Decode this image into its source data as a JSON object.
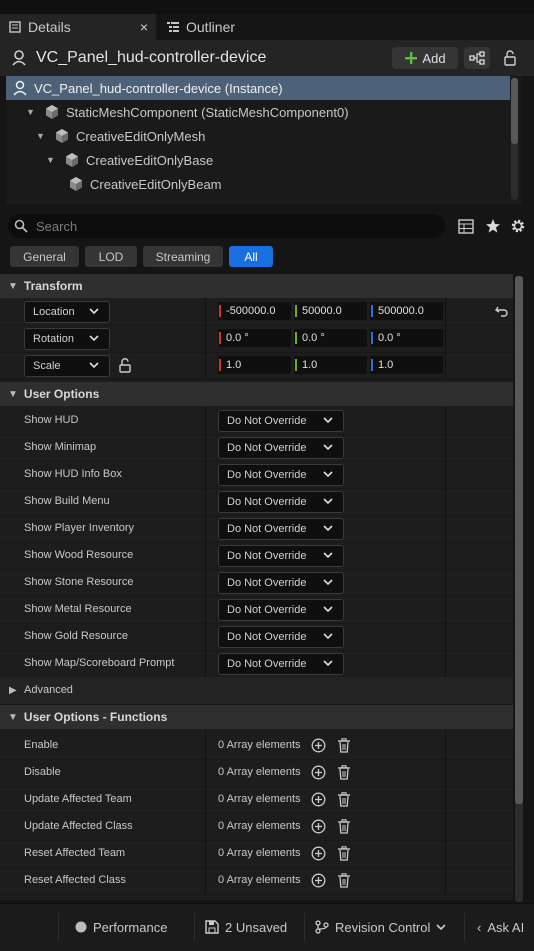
{
  "tabs": [
    {
      "label": "Details",
      "icon": "details-icon",
      "close": "×"
    },
    {
      "label": "Outliner",
      "icon": "outliner-icon"
    }
  ],
  "header": {
    "title": "VC_Panel_hud-controller-device",
    "add_label": "Add"
  },
  "tree": [
    {
      "label": "VC_Panel_hud-controller-device (Instance)",
      "selected": true
    },
    {
      "label": "StaticMeshComponent (StaticMeshComponent0)"
    },
    {
      "label": "CreativeEditOnlyMesh"
    },
    {
      "label": "CreativeEditOnlyBase"
    },
    {
      "label": "CreativeEditOnlyBeam"
    }
  ],
  "search": {
    "placeholder": "Search"
  },
  "filters": [
    "General",
    "LOD",
    "Streaming",
    "All"
  ],
  "active_filter": "All",
  "transform": {
    "title": "Transform",
    "rows": [
      {
        "label": "Location",
        "values": [
          "-500000.0",
          "50000.0",
          "500000.0"
        ]
      },
      {
        "label": "Rotation",
        "values": [
          "0.0 °",
          "0.0 °",
          "0.0 °"
        ]
      },
      {
        "label": "Scale",
        "values": [
          "1.0",
          "1.0",
          "1.0"
        ]
      }
    ]
  },
  "axis_colors": [
    "#c93a2e",
    "#6fae1c",
    "#2f6fd9"
  ],
  "user_options": {
    "title": "User Options",
    "rows": [
      {
        "label": "Show HUD",
        "value": "Do Not Override"
      },
      {
        "label": "Show Minimap",
        "value": "Do Not Override"
      },
      {
        "label": "Show HUD Info Box",
        "value": "Do Not Override"
      },
      {
        "label": "Show Build Menu",
        "value": "Do Not Override"
      },
      {
        "label": "Show Player Inventory",
        "value": "Do Not Override"
      },
      {
        "label": "Show Wood Resource",
        "value": "Do Not Override"
      },
      {
        "label": "Show Stone Resource",
        "value": "Do Not Override"
      },
      {
        "label": "Show Metal Resource",
        "value": "Do Not Override"
      },
      {
        "label": "Show Gold Resource",
        "value": "Do Not Override"
      },
      {
        "label": "Show Map/Scoreboard Prompt",
        "value": "Do Not Override"
      }
    ]
  },
  "advanced": {
    "label": "Advanced"
  },
  "functions": {
    "title": "User Options - Functions",
    "rows": [
      {
        "label": "Enable",
        "value": "0 Array elements"
      },
      {
        "label": "Disable",
        "value": "0 Array elements"
      },
      {
        "label": "Update Affected Team",
        "value": "0 Array elements"
      },
      {
        "label": "Update Affected Class",
        "value": "0 Array elements"
      },
      {
        "label": "Reset Affected Team",
        "value": "0 Array elements"
      },
      {
        "label": "Reset Affected Class",
        "value": "0 Array elements"
      }
    ]
  },
  "statusbar": {
    "performance": "Performance",
    "unsaved": "2 Unsaved",
    "revision": "Revision Control",
    "ask_ai": "Ask AI"
  },
  "colors": {
    "accent": "#1a6fe0",
    "selection": "#4d6179",
    "add_icon": "#5fbf3a"
  }
}
